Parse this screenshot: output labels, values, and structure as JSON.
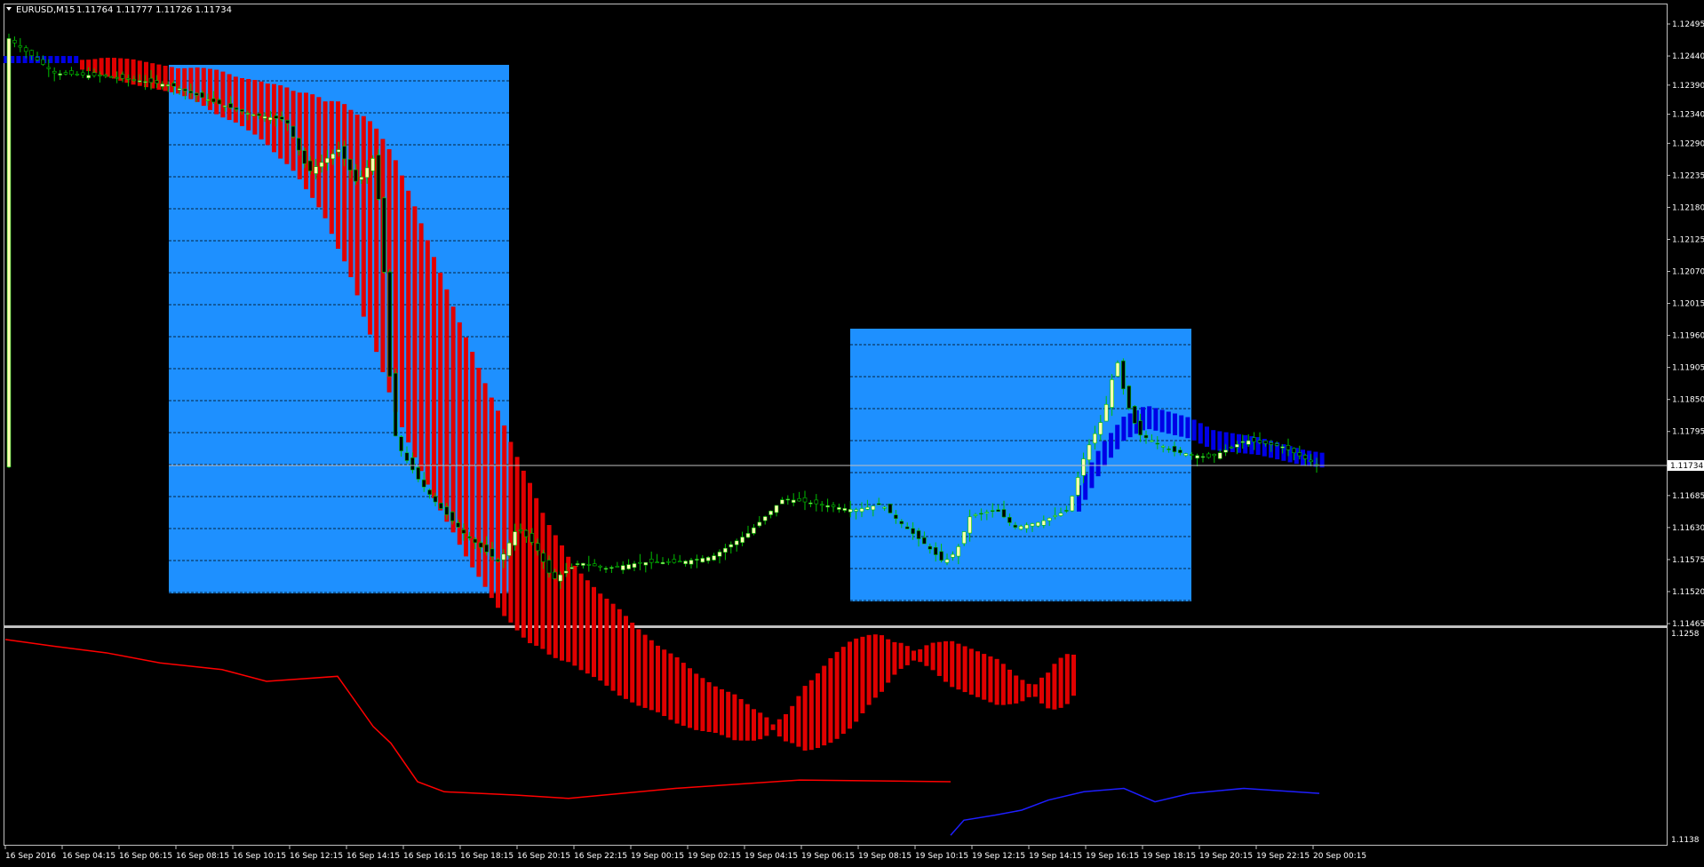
{
  "header": {
    "symbol": "EURUSD,M15",
    "ohlc": "1.11764 1.11777 1.11726 1.11734"
  },
  "colors": {
    "background": "#000000",
    "grid_border": "#c0c0c0",
    "zone_fill": "#1e90ff",
    "band_bear": "#e00000",
    "band_bull": "#0000e6",
    "bull_candle": "#ffffb0",
    "bear_candle": "#000000",
    "wick": "#00c000",
    "line_bear": "#ff0000",
    "line_bull": "#1e1eff"
  },
  "price_axis": {
    "ticks": [
      "1.12495",
      "1.12440",
      "1.12390",
      "1.12340",
      "1.12290",
      "1.12235",
      "1.12180",
      "1.12125",
      "1.12070",
      "1.12015",
      "1.11960",
      "1.11905",
      "1.11850",
      "1.11795",
      "1.11685",
      "1.11630",
      "1.11575",
      "1.11520",
      "1.11465"
    ],
    "current": "1.11734"
  },
  "sub_axis": {
    "top": "1.1258",
    "bottom": "1.1138"
  },
  "time_axis": {
    "labels": [
      "16 Sep 2016",
      "16 Sep 04:15",
      "16 Sep 06:15",
      "16 Sep 08:15",
      "16 Sep 10:15",
      "16 Sep 12:15",
      "16 Sep 14:15",
      "16 Sep 16:15",
      "16 Sep 18:15",
      "16 Sep 20:15",
      "16 Sep 22:15",
      "19 Sep 00:15",
      "19 Sep 02:15",
      "19 Sep 04:15",
      "19 Sep 06:15",
      "19 Sep 08:15",
      "19 Sep 10:15",
      "19 Sep 12:15",
      "19 Sep 14:15",
      "19 Sep 16:15",
      "19 Sep 18:15",
      "19 Sep 20:15",
      "19 Sep 22:15",
      "20 Sep 00:15"
    ]
  },
  "chart_data": {
    "type": "candlestick",
    "symbol": "EURUSD",
    "timeframe": "M15",
    "price_range": [
      1.11465,
      1.1252
    ],
    "zones": [
      {
        "from": "16 Sep 08:15",
        "to": "16 Sep 18:15",
        "high": 1.12425,
        "low": 1.11515
      },
      {
        "from": "19 Sep 08:15",
        "to": "19 Sep 16:15",
        "high": 1.11975,
        "low": 1.11505
      }
    ],
    "band_bear_price": [
      1.12425,
      1.1242,
      1.1241,
      1.124,
      1.1239,
      1.1237,
      1.1235,
      1.1232,
      1.1228,
      1.1222,
      1.1213,
      1.1201,
      1.1189,
      1.1178,
      1.1168,
      1.1159,
      1.1152,
      1.1147,
      1.1143,
      1.1139,
      1.1136,
      1.1133,
      1.1131,
      1.1129,
      1.11285,
      1.1131,
      1.1135,
      1.1139,
      1.1141,
      1.1141,
      1.1139,
      1.1137,
      1.1135,
      1.1135,
      1.1138
    ],
    "band_bull_price": [
      1.1168,
      1.1175,
      1.118,
      1.1182,
      1.1181,
      1.118,
      1.1178,
      1.11775,
      1.1177,
      1.1176,
      1.1175,
      1.11745
    ],
    "subwindow_line": {
      "range": [
        1.1138,
        1.1258
      ],
      "bear": [
        1.1257,
        1.1253,
        1.1249,
        1.1243,
        1.1239,
        1.1232,
        1.1235,
        1.1205,
        1.1195,
        1.1172,
        1.1166,
        1.1164,
        1.1162,
        1.1165,
        1.1168,
        1.1173,
        1.1172
      ],
      "bull": [
        1.114,
        1.1149,
        1.1152,
        1.1155,
        1.1161,
        1.1166,
        1.1168,
        1.116,
        1.1165,
        1.1168,
        1.1165
      ]
    }
  }
}
